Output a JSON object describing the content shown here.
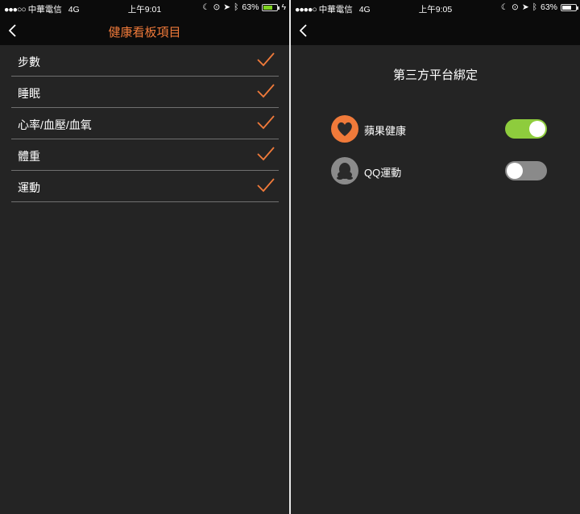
{
  "left_screen": {
    "status": {
      "signal": "●●●○○",
      "carrier": "中華電信",
      "network": "4G",
      "time": "上午9:01",
      "battery": "63%"
    },
    "nav": {
      "title": "健康看板項目"
    },
    "items": [
      {
        "label": "步數",
        "checked": true
      },
      {
        "label": "睡眠",
        "checked": true
      },
      {
        "label": "心率/血壓/血氧",
        "checked": true
      },
      {
        "label": "體重",
        "checked": true
      },
      {
        "label": "運動",
        "checked": true
      }
    ]
  },
  "right_screen": {
    "status": {
      "signal": "●●●●○",
      "carrier": "中華電信",
      "network": "4G",
      "time": "上午9:05",
      "battery": "63%"
    },
    "heading": "第三方平台綁定",
    "bindings": [
      {
        "label": "蘋果健康",
        "icon": "heart-icon",
        "enabled": true
      },
      {
        "label": "QQ運動",
        "icon": "qq-penguin-icon",
        "enabled": false
      }
    ]
  },
  "colors": {
    "accent": "#f07a3a",
    "toggle_on": "#8ecc3d",
    "background": "#242424",
    "bar": "#0b0b0b"
  }
}
